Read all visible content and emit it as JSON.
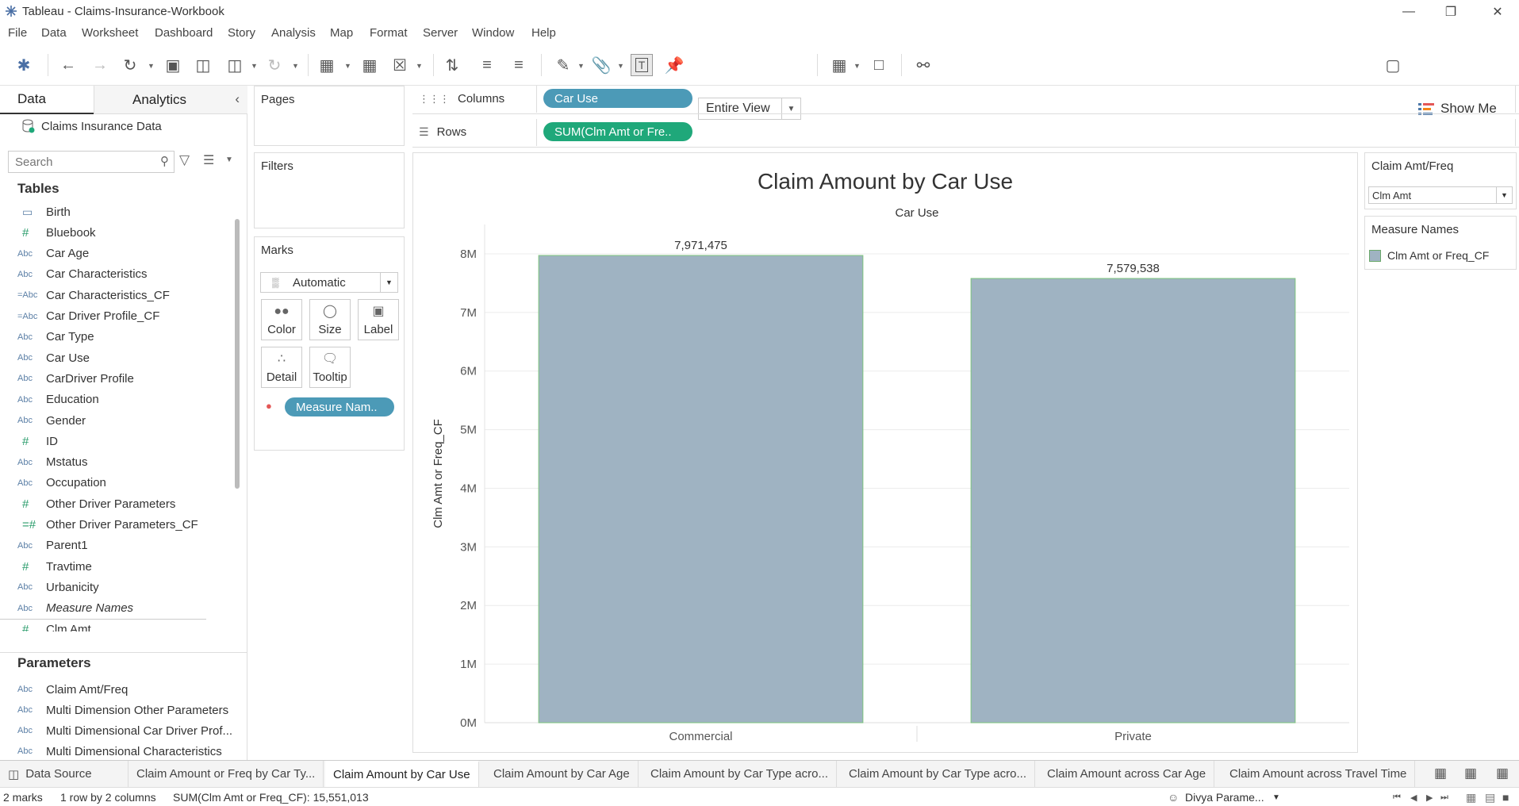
{
  "window": {
    "title": "Tableau - Claims-Insurance-Workbook"
  },
  "menu": [
    "File",
    "Data",
    "Worksheet",
    "Dashboard",
    "Story",
    "Analysis",
    "Map",
    "Format",
    "Server",
    "Window",
    "Help"
  ],
  "toolbar": {
    "view_mode": "Entire View",
    "show_me": "Show Me"
  },
  "left_pane": {
    "tab_data": "Data",
    "tab_analytics": "Analytics",
    "datasource": "Claims Insurance Data",
    "search_placeholder": "Search",
    "tables_header": "Tables",
    "fields": [
      {
        "type": "date",
        "name": "Birth"
      },
      {
        "type": "num",
        "name": "Bluebook"
      },
      {
        "type": "abc",
        "name": "Car Age"
      },
      {
        "type": "abc",
        "name": "Car Characteristics"
      },
      {
        "type": "calc",
        "name": "Car Characteristics_CF"
      },
      {
        "type": "calc",
        "name": "Car Driver Profile_CF"
      },
      {
        "type": "abc",
        "name": "Car Type"
      },
      {
        "type": "abc",
        "name": "Car Use"
      },
      {
        "type": "abc",
        "name": "CarDriver Profile"
      },
      {
        "type": "abc",
        "name": "Education"
      },
      {
        "type": "abc",
        "name": "Gender"
      },
      {
        "type": "num",
        "name": "ID"
      },
      {
        "type": "abc",
        "name": "Mstatus"
      },
      {
        "type": "abc",
        "name": "Occupation"
      },
      {
        "type": "num",
        "name": "Other Driver Parameters"
      },
      {
        "type": "calcnum",
        "name": "Other Driver Parameters_CF"
      },
      {
        "type": "abc",
        "name": "Parent1"
      },
      {
        "type": "num",
        "name": "Travtime"
      },
      {
        "type": "abc",
        "name": "Urbanicity"
      },
      {
        "type": "abc",
        "name": "Measure Names"
      },
      {
        "type": "num",
        "name": "Clm Amt"
      }
    ],
    "parameters_header": "Parameters",
    "parameters": [
      "Claim Amt/Freq",
      "Multi Dimension Other Parameters",
      "Multi Dimensional Car Driver Prof...",
      "Multi Dimensional Characteristics"
    ],
    "type_labels": {
      "abc": "Abc",
      "num": "#",
      "date": "▭",
      "calc": "=Abc",
      "calcnum": "=#"
    }
  },
  "cards": {
    "pages": "Pages",
    "filters": "Filters",
    "marks": "Marks",
    "marks_type": "Automatic",
    "marks_buttons": [
      "Color",
      "Size",
      "Label",
      "Detail",
      "Tooltip"
    ],
    "marks_pill": "Measure Nam.."
  },
  "shelves": {
    "columns_label": "Columns",
    "columns_pill": "Car Use",
    "rows_label": "Rows",
    "rows_pill": "SUM(Clm Amt or Fre.."
  },
  "parameter_card": {
    "title": "Claim Amt/Freq",
    "value": "Clm Amt"
  },
  "legend_card": {
    "title": "Measure Names",
    "item": "Clm Amt or Freq_CF",
    "color": "#9fb3c2"
  },
  "chart_data": {
    "type": "bar",
    "title": "Claim Amount by Car Use",
    "header": "Car Use",
    "categories": [
      "Commercial",
      "Private"
    ],
    "values": [
      7971475,
      7579538
    ],
    "value_labels": [
      "7,971,475",
      "7,579,538"
    ],
    "ylabel": "Clm Amt or Freq_CF",
    "ylim": [
      0,
      8500000
    ],
    "yticks": [
      0,
      1000000,
      2000000,
      3000000,
      4000000,
      5000000,
      6000000,
      7000000,
      8000000
    ],
    "ytick_labels": [
      "0M",
      "1M",
      "2M",
      "3M",
      "4M",
      "5M",
      "6M",
      "7M",
      "8M"
    ],
    "bar_color": "#9fb3c2",
    "bar_edge": "#7cc47c",
    "grid": true
  },
  "sheet_tabs": {
    "datasource": "Data Source",
    "tabs": [
      "Claim Amount or Freq by Car Ty...",
      "Claim Amount by Car Use",
      "Claim Amount by Car Age",
      "Claim Amount by Car Type acro...",
      "Claim Amount by Car Type acro...",
      "Claim Amount across Car Age",
      "Claim Amount across Travel Time"
    ],
    "active": 1
  },
  "status": {
    "marks": "2 marks",
    "dims": "1 row by 2 columns",
    "sum": "SUM(Clm Amt or Freq_CF): 15,551,013",
    "user": "Divya Parame..."
  }
}
